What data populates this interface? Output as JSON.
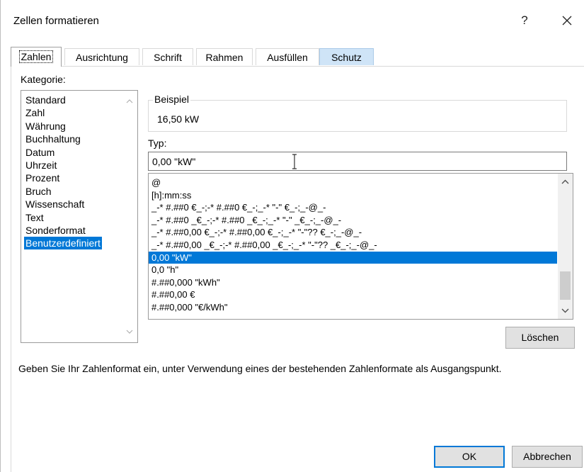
{
  "window": {
    "title": "Zellen formatieren",
    "help_label": "?"
  },
  "tabs": [
    {
      "label": "Zahlen",
      "active": true
    },
    {
      "label": "Ausrichtung"
    },
    {
      "label": "Schrift"
    },
    {
      "label": "Rahmen"
    },
    {
      "label": "Ausfüllen"
    },
    {
      "label": "Schutz"
    }
  ],
  "category": {
    "label": "Kategorie:",
    "items": [
      "Standard",
      "Zahl",
      "Währung",
      "Buchhaltung",
      "Datum",
      "Uhrzeit",
      "Prozent",
      "Bruch",
      "Wissenschaft",
      "Text",
      "Sonderformat",
      "Benutzerdefiniert"
    ],
    "selected": "Benutzerdefiniert"
  },
  "sample": {
    "legend": "Beispiel",
    "value": "16,50 kW"
  },
  "type": {
    "label": "Typ:",
    "value": "0,00 \"kW\""
  },
  "formats": {
    "items": [
      "@",
      "[h]:mm:ss",
      "_-* #.##0 €_-;-* #.##0 €_-;_-* \"-\" €_-;_-@_-",
      "_-* #.##0 _€_-;-* #.##0 _€_-;_-* \"-\" _€_-;_-@_-",
      "_-* #.##0,00 €_-;-* #.##0,00 €_-;_-* \"-\"?? €_-;_-@_-",
      "_-* #.##0,00 _€_-;-* #.##0,00 _€_-;_-* \"-\"?? _€_-;_-@_-",
      "0,00 \"kW\"",
      "0,0 \"h\"",
      "#.##0,000 \"kWh\"",
      "#.##0,00 €",
      "#.##0,000 \"€/kWh\""
    ],
    "selected": "0,00 \"kW\""
  },
  "buttons": {
    "delete": "Löschen",
    "ok": "OK",
    "cancel": "Abbrechen"
  },
  "hint": "Geben Sie Ihr Zahlenformat ein, unter Verwendung eines der bestehenden Zahlenformate als Ausgangspunkt.",
  "colors": {
    "selection": "#0078d7",
    "active_tab_highlight": "#cfe4f7"
  }
}
